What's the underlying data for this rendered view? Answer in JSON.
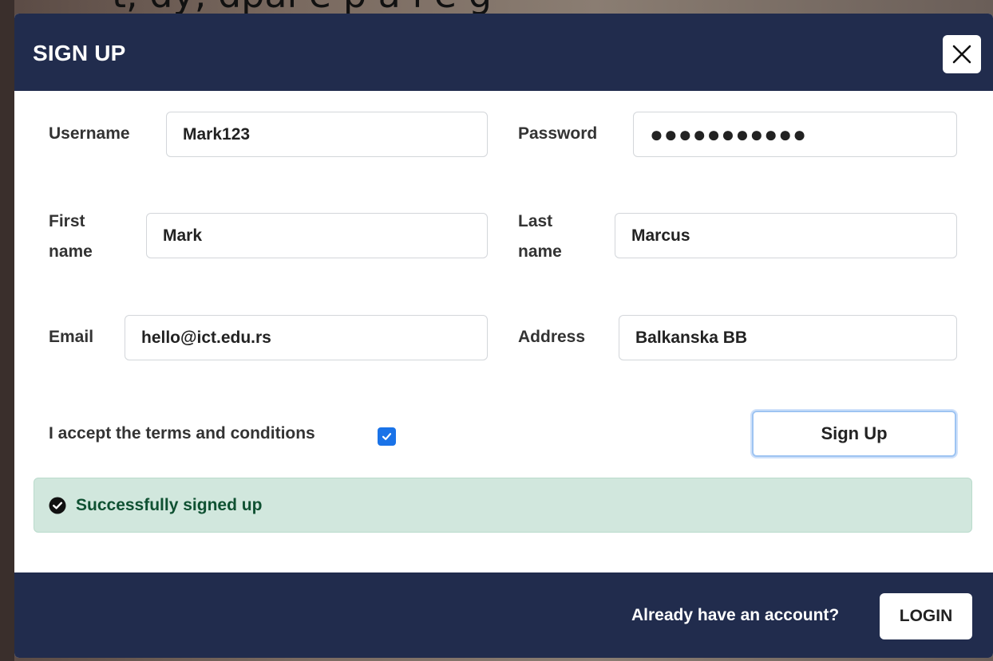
{
  "background": {
    "partial_text": "t, dy, dpai e p a i e g"
  },
  "modal": {
    "title": "SIGN UP",
    "close_icon": "close-icon"
  },
  "form": {
    "username": {
      "label": "Username",
      "value": "Mark123"
    },
    "password": {
      "label": "Password",
      "value": "●●●●●●●●●●●"
    },
    "first_name": {
      "label_line1": "First",
      "label_line2": "name",
      "value": "Mark"
    },
    "last_name": {
      "label_line1": "Last",
      "label_line2": "name",
      "value": "Marcus"
    },
    "email": {
      "label": "Email",
      "value": "hello@ict.edu.rs"
    },
    "address": {
      "label": "Address",
      "value": "Balkanska BB"
    },
    "terms": {
      "label": "I accept the terms and conditions",
      "checked": true
    },
    "submit_label": "Sign Up"
  },
  "alert": {
    "icon": "check-circle-icon",
    "message": "Successfully signed up"
  },
  "footer": {
    "prompt": "Already have an account?",
    "login_label": "LOGIN"
  },
  "colors": {
    "header_bg": "#212c4d",
    "checkbox": "#1a73e8",
    "alert_bg": "#d1e7dd",
    "alert_text": "#0f5132"
  }
}
